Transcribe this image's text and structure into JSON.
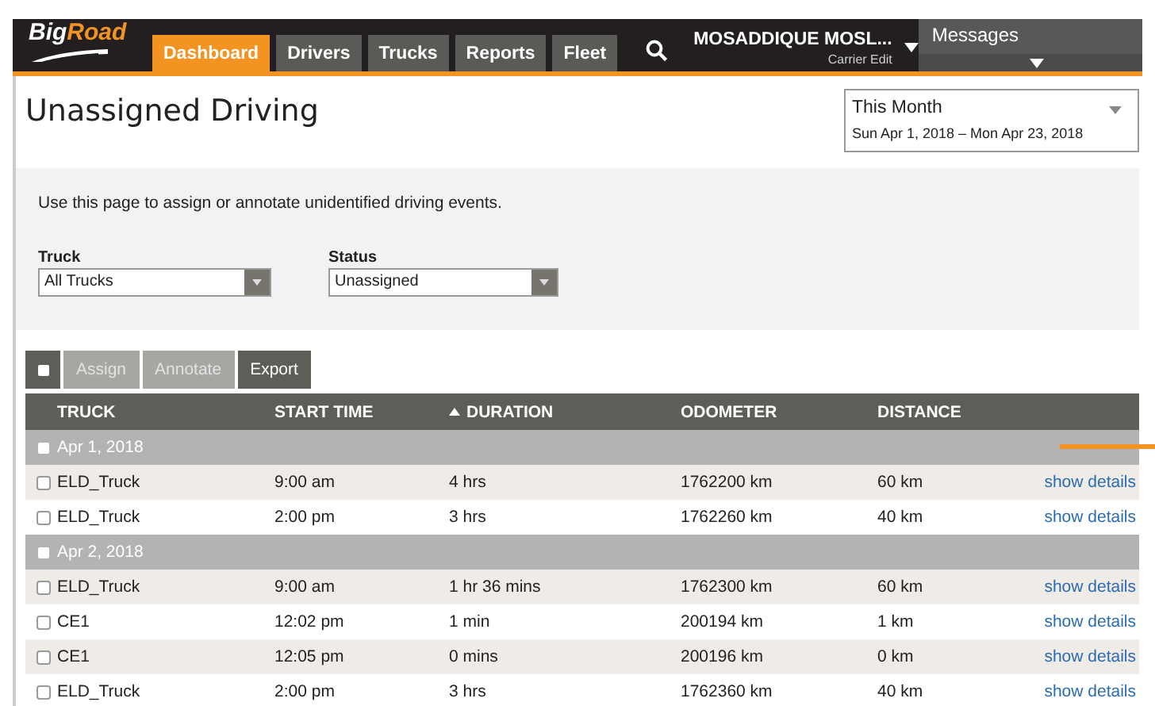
{
  "logo": {
    "parts": [
      "Big",
      "Road"
    ]
  },
  "nav": {
    "tabs": [
      {
        "label": "Dashboard",
        "selected": true
      },
      {
        "label": "Drivers",
        "selected": false
      },
      {
        "label": "Trucks",
        "selected": false
      },
      {
        "label": "Reports",
        "selected": false
      },
      {
        "label": "Fleet",
        "selected": false
      }
    ],
    "user": {
      "name": "MOSADDIQUE MOSL...",
      "role": "Carrier Edit"
    },
    "messages": {
      "label": "Messages"
    }
  },
  "page_title": "Unassigned Driving",
  "date_range": {
    "label": "This Month",
    "range": "Sun Apr 1, 2018 – Mon Apr 23, 2018"
  },
  "intro": "Use this page to assign or annotate unidentified driving events.",
  "filters": [
    {
      "label": "Truck",
      "value": "All Trucks"
    },
    {
      "label": "Status",
      "value": "Unassigned"
    }
  ],
  "toolbar": {
    "select_all": {
      "checked": false
    },
    "buttons": [
      {
        "label": "Assign",
        "disabled": true
      },
      {
        "label": "Annotate",
        "disabled": true
      },
      {
        "label": "Export",
        "disabled": false
      }
    ]
  },
  "table": {
    "columns": [
      {
        "label": "TRUCK",
        "sorted": false
      },
      {
        "label": "START TIME",
        "sorted": false
      },
      {
        "label": "DURATION",
        "sorted": true
      },
      {
        "label": "ODOMETER",
        "sorted": false
      },
      {
        "label": "DISTANCE",
        "sorted": false
      }
    ],
    "groups": [
      {
        "date": "Apr 1, 2018",
        "checked": false,
        "rows": [
          {
            "checked": false,
            "cells": [
              "ELD_Truck",
              "9:00 am",
              "4 hrs",
              "1762200 km",
              "60 km"
            ],
            "link": "show details"
          },
          {
            "checked": false,
            "cells": [
              "ELD_Truck",
              "2:00 pm",
              "3 hrs",
              "1762260 km",
              "40 km"
            ],
            "link": "show details"
          }
        ]
      },
      {
        "date": "Apr 2, 2018",
        "checked": false,
        "rows": [
          {
            "checked": false,
            "cells": [
              "ELD_Truck",
              "9:00 am",
              "1 hr 36 mins",
              "1762300 km",
              "60 km"
            ],
            "link": "show details"
          },
          {
            "checked": false,
            "cells": [
              "CE1",
              "12:02 pm",
              "1 min",
              "200194 km",
              "1 km"
            ],
            "link": "show details"
          },
          {
            "checked": false,
            "cells": [
              "CE1",
              "12:05 pm",
              "0 mins",
              "200196 km",
              "0 km"
            ],
            "link": "show details"
          },
          {
            "checked": false,
            "cells": [
              "ELD_Truck",
              "2:00 pm",
              "3 hrs",
              "1762360 km",
              "40 km"
            ],
            "link": "show details"
          }
        ]
      }
    ]
  }
}
